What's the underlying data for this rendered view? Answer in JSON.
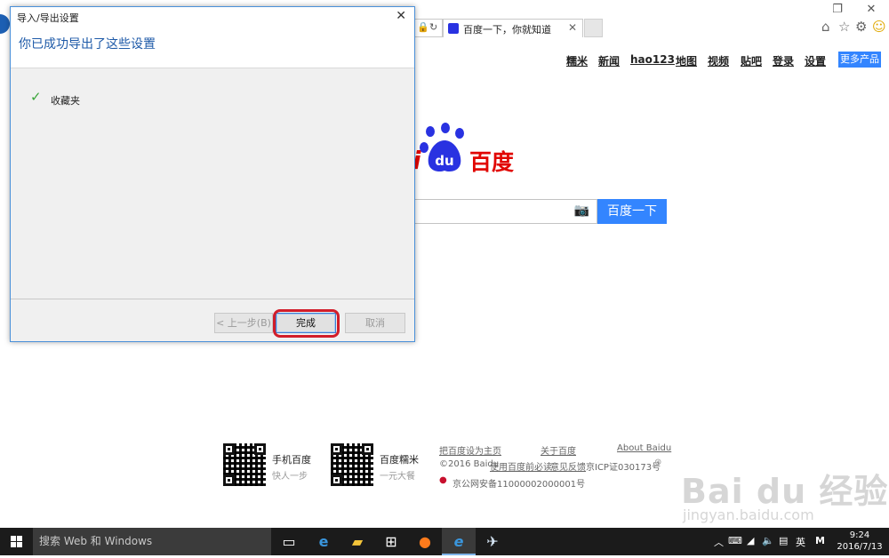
{
  "browser": {
    "tab_title": "百度一下，你就知道",
    "tab_close": "✕",
    "window_buttons": {
      "restore": "❐",
      "close": "✕"
    },
    "toolbar_icons": [
      "home-icon",
      "favorites-star-icon",
      "settings-gear-icon",
      "feedback-smiley-icon"
    ]
  },
  "baidu": {
    "nav": [
      "糯米",
      "新闻",
      "hao123",
      "地图",
      "视频",
      "贴吧",
      "登录",
      "设置"
    ],
    "more_products": "更多产品",
    "logo_text_partial": "i",
    "logo_du": "du",
    "logo_cn": "百度",
    "search_button": "百度一下",
    "footer": {
      "qr1_title": "手机百度",
      "qr1_sub": "快人一步",
      "qr2_title": "百度糯米",
      "qr2_sub": "一元大餐",
      "set_home": "把百度设为主页",
      "about": "关于百度",
      "about_en": "About  Baidu",
      "copyright": "©2016 Baidu",
      "must_read": "使用百度前必读",
      "feedback": "意见反馈",
      "icp": "京ICP证030173号",
      "police": "京公网安备11000002000001号"
    }
  },
  "dialog": {
    "title": "导入/导出设置",
    "close": "✕",
    "heading": "你已成功导出了这些设置",
    "item": "收藏夹",
    "back_button": "< 上一步(B)",
    "finish_button": "完成",
    "cancel_button": "取消"
  },
  "taskbar": {
    "search_placeholder": "搜索 Web 和 Windows",
    "tray_lang": "英",
    "tray_ime": "M",
    "time": "9:24",
    "date": "2016/7/13"
  },
  "watermark": {
    "big": "Bai du 经验",
    "small": "jingyan.baidu.com"
  },
  "colors": {
    "baidu_blue": "#3385ff",
    "baidu_red": "#e10602",
    "highlight_ring": "#d11d2a",
    "taskbar": "#1b1b1b"
  }
}
